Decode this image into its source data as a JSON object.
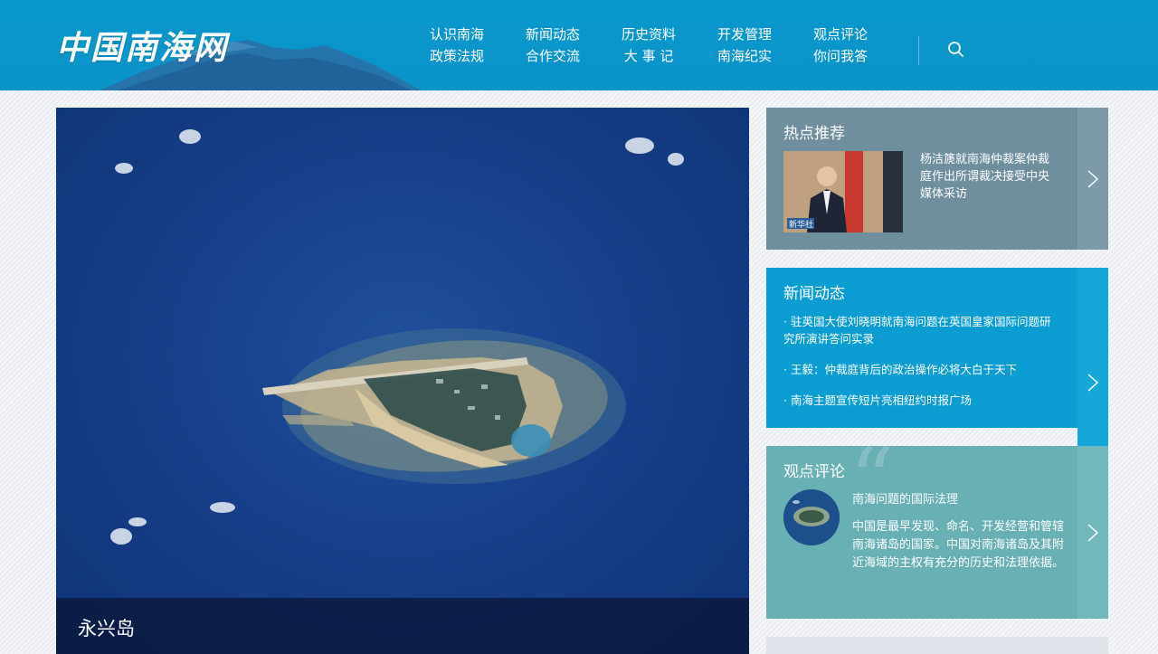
{
  "header": {
    "logo": "中国南海网",
    "nav": [
      {
        "top": "认识南海",
        "bottom": "政策法规"
      },
      {
        "top": "新闻动态",
        "bottom": "合作交流"
      },
      {
        "top": "历史资料",
        "bottom": "大 事 记"
      },
      {
        "top": "开发管理",
        "bottom": "南海纪实"
      },
      {
        "top": "观点评论",
        "bottom": "你问我答"
      }
    ],
    "search_icon": "search-icon"
  },
  "hero": {
    "caption": "永兴岛"
  },
  "hot": {
    "title": "热点推荐",
    "headline": "杨洁篪就南海仲裁案仲裁庭作出所谓裁决接受中央媒体采访",
    "thumb_tag": "新华社"
  },
  "news": {
    "title": "新闻动态",
    "items": [
      "· 驻英国大使刘晓明就南海问题在英国皇家国际问题研究所演讲答问实录",
      "· 王毅：仲裁庭背后的政治操作必将大白于天下",
      "· 南海主题宣传短片亮相纽约时报广场"
    ]
  },
  "opinion": {
    "title": "观点评论",
    "headline": "南海问题的国际法理",
    "body": "中国是最早发现、命名、开发经营和管辖南海诸岛的国家。中国对南海诸岛及其附近海域的主权有充分的历史和法理依据。"
  },
  "colors": {
    "header": "#0a98cc",
    "hot_panel": "#6f8f9e",
    "news_panel": "#0b9dd1",
    "opinion_panel": "#69b0b5"
  }
}
